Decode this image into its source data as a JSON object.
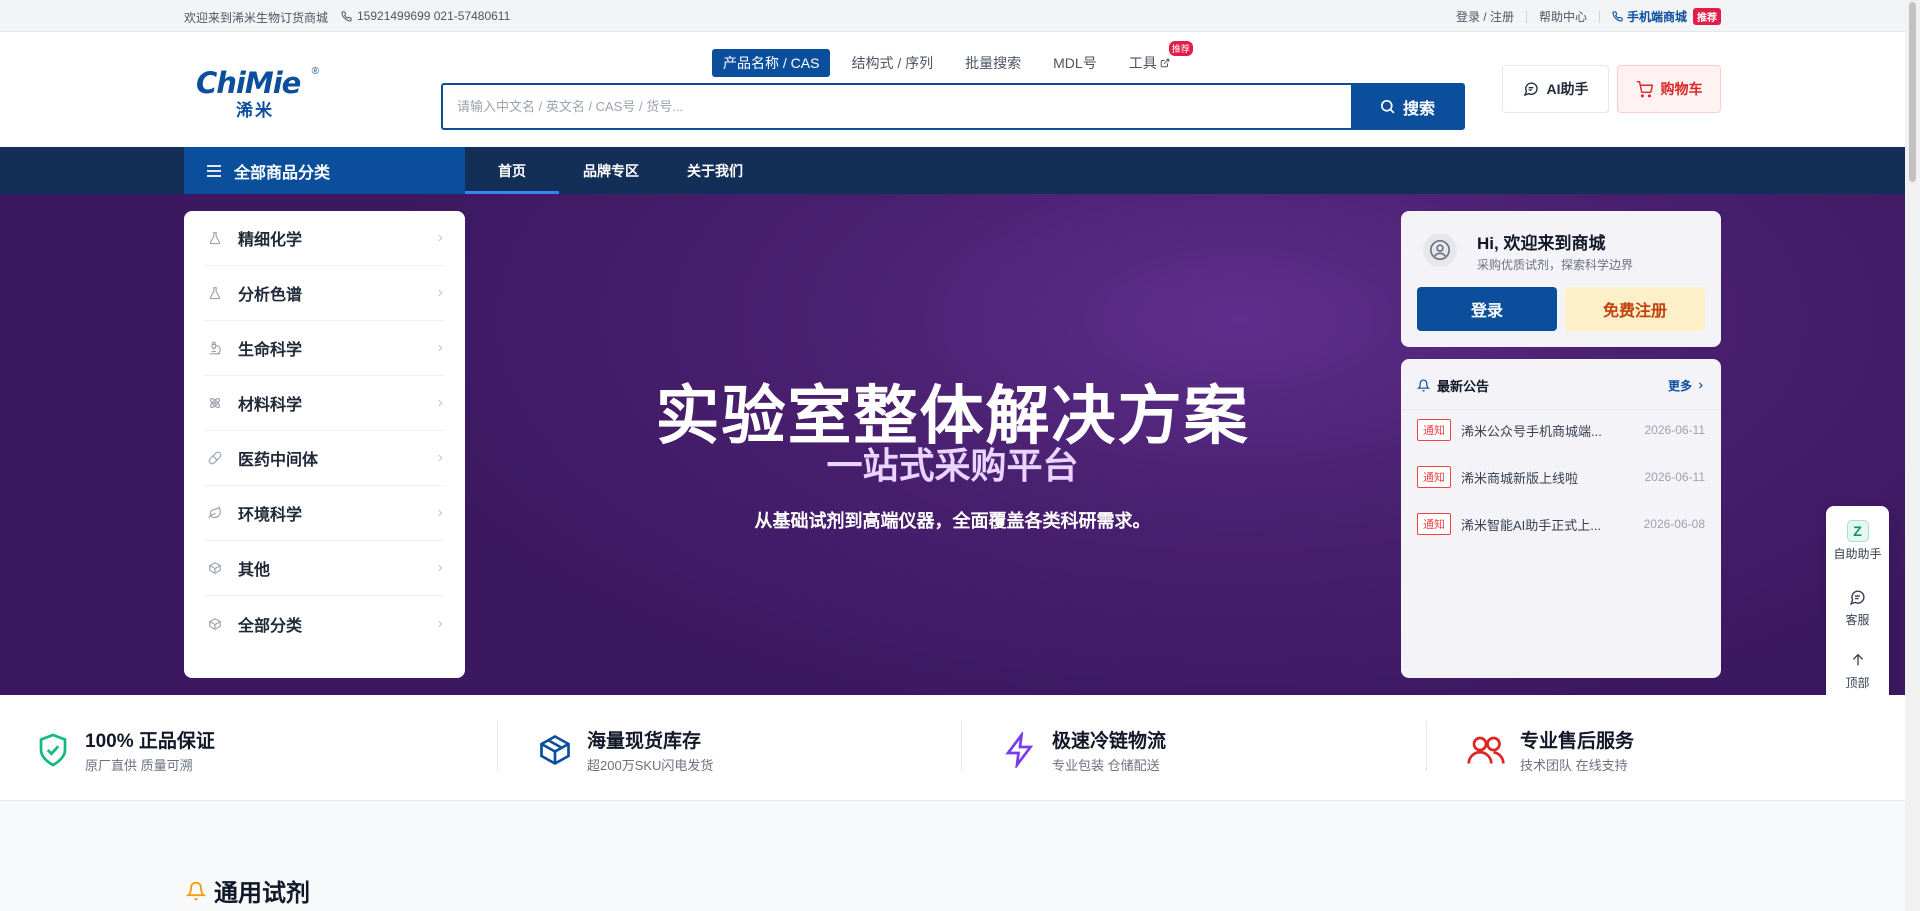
{
  "topbar": {
    "welcome": "欢迎来到浠米生物订货商城",
    "phone": "15921499699 021-57480611",
    "login_register": "登录 / 注册",
    "help": "帮助中心",
    "mobile": "手机端商城",
    "mobile_badge": "推荐"
  },
  "header": {
    "logo_en": "ChiMie",
    "logo_reg": "®",
    "logo_cn": "浠米",
    "search_tabs": [
      {
        "label": "产品名称 / CAS",
        "active": true
      },
      {
        "label": "结构式 / 序列"
      },
      {
        "label": "批量搜索"
      },
      {
        "label": "MDL号"
      },
      {
        "label": "工具",
        "badge": "推荐"
      }
    ],
    "search_placeholder": "请输入中文名 / 英文名 / CAS号 / 货号...",
    "search_button": "搜索",
    "ai_button": "AI助手",
    "cart_button": "购物车"
  },
  "nav": {
    "all_categories": "全部商品分类",
    "links": [
      {
        "label": "首页",
        "active": true
      },
      {
        "label": "品牌专区"
      },
      {
        "label": "关于我们"
      }
    ]
  },
  "hero": {
    "title": "实验室整体解决方案",
    "subtitle": "一站式采购平台",
    "description": "从基础试剂到高端仪器，全面覆盖各类科研需求。"
  },
  "categories": [
    {
      "label": "精细化学",
      "icon": "flask-icon"
    },
    {
      "label": "分析色谱",
      "icon": "flask-icon"
    },
    {
      "label": "生命科学",
      "icon": "microscope-icon"
    },
    {
      "label": "材料科学",
      "icon": "atom-icon"
    },
    {
      "label": "医药中间体",
      "icon": "pill-icon"
    },
    {
      "label": "环境科学",
      "icon": "leaf-icon"
    },
    {
      "label": "其他",
      "icon": "box-icon"
    },
    {
      "label": "全部分类",
      "icon": "box-icon"
    }
  ],
  "welcome_card": {
    "greeting": "Hi, 欢迎来到商城",
    "subtitle": "采购优质试剂，探索科学边界",
    "login": "登录",
    "register": "免费注册"
  },
  "announcements": {
    "title": "最新公告",
    "more": "更多",
    "items": [
      {
        "tag": "通知",
        "text": "浠米公众号手机商城端...",
        "date": "2026-06-11"
      },
      {
        "tag": "通知",
        "text": "浠米商城新版上线啦",
        "date": "2026-06-11"
      },
      {
        "tag": "通知",
        "text": "浠米智能AI助手正式上...",
        "date": "2026-06-08"
      }
    ]
  },
  "float_tools": {
    "self_service_badge": "Z",
    "self_service": "自助助手",
    "service": "客服",
    "top": "顶部"
  },
  "features": [
    {
      "title": "100% 正品保证",
      "subtitle": "原厂直供 质量可溯",
      "icon": "shield-check-icon",
      "color": "#10b981"
    },
    {
      "title": "海量现货库存",
      "subtitle": "超200万SKU闪电发货",
      "icon": "package-icon",
      "color": "#0b4f9c"
    },
    {
      "title": "极速冷链物流",
      "subtitle": "专业包装 仓储配送",
      "icon": "zap-icon",
      "color": "#7c3aed"
    },
    {
      "title": "专业售后服务",
      "subtitle": "技术团队 在线支持",
      "icon": "users-icon",
      "color": "#dc2626"
    }
  ],
  "section": {
    "title": "通用试剂"
  },
  "colors": {
    "brand_blue": "#0b4f9c",
    "nav_dark": "#132f57",
    "hero_purple": "#4a2070",
    "alert_red": "#e11d48"
  }
}
